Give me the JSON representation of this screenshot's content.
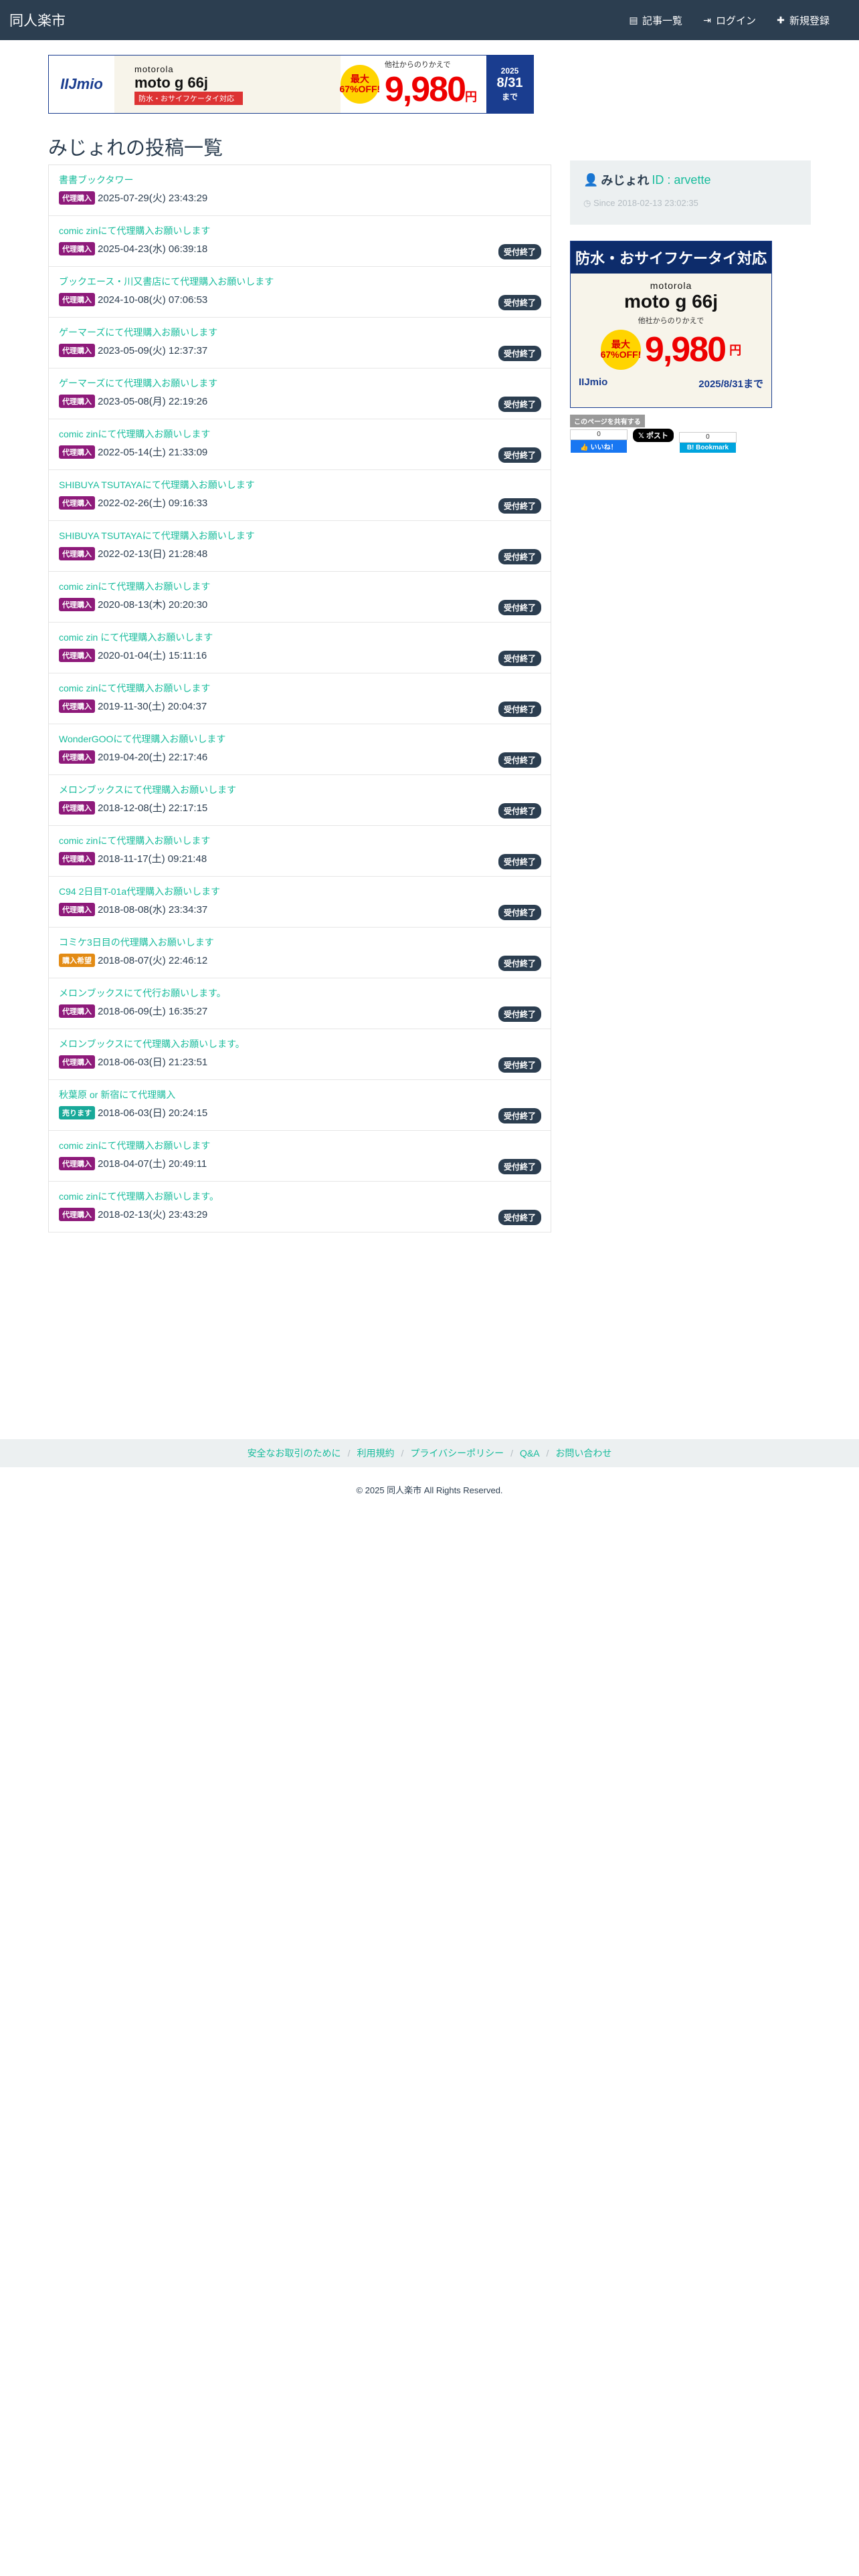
{
  "nav": {
    "brand": "同人楽市",
    "links": [
      {
        "icon": "list-icon",
        "label": "記事一覧"
      },
      {
        "icon": "login-icon",
        "label": "ログイン"
      },
      {
        "icon": "plus-icon",
        "label": "新規登録"
      }
    ]
  },
  "ad_top": {
    "logo": "IIJmio",
    "brand": "motorola",
    "phone": "moto g 66j",
    "tagline": "防水・おサイフケータイ対応",
    "note": "他社からのりかえで",
    "discount": "最大67%OFF!",
    "price": "9,980",
    "yen": "円",
    "year": "2025",
    "until": "8/31",
    "made": "まで"
  },
  "page": {
    "title": "みじょれの投稿一覧"
  },
  "colors": {
    "accent": "#18bc9c",
    "navbar": "#2c3e50",
    "purchase_label": "#8e1a7a",
    "wanted_label": "#e38b14",
    "sell_label": "#18a999"
  },
  "posts": [
    {
      "title": "書書ブックタワー",
      "label": "代理購入",
      "label_color": "#8e1a7a",
      "date": "2025-07-29(火) 23:43:29",
      "status": ""
    },
    {
      "title": "comic zinにて代理購入お願いします",
      "label": "代理購入",
      "label_color": "#8e1a7a",
      "date": "2025-04-23(水) 06:39:18",
      "status": "受付終了"
    },
    {
      "title": "ブックエース・川又書店にて代理購入お願いします",
      "label": "代理購入",
      "label_color": "#8e1a7a",
      "date": "2024-10-08(火) 07:06:53",
      "status": "受付終了"
    },
    {
      "title": "ゲーマーズにて代理購入お願いします",
      "label": "代理購入",
      "label_color": "#8e1a7a",
      "date": "2023-05-09(火) 12:37:37",
      "status": "受付終了"
    },
    {
      "title": "ゲーマーズにて代理購入お願いします",
      "label": "代理購入",
      "label_color": "#8e1a7a",
      "date": "2023-05-08(月) 22:19:26",
      "status": "受付終了"
    },
    {
      "title": "comic zinにて代理購入お願いします",
      "label": "代理購入",
      "label_color": "#8e1a7a",
      "date": "2022-05-14(土) 21:33:09",
      "status": "受付終了"
    },
    {
      "title": "SHIBUYA TSUTAYAにて代理購入お願いします",
      "label": "代理購入",
      "label_color": "#8e1a7a",
      "date": "2022-02-26(土) 09:16:33",
      "status": "受付終了"
    },
    {
      "title": "SHIBUYA TSUTAYAにて代理購入お願いします",
      "label": "代理購入",
      "label_color": "#8e1a7a",
      "date": "2022-02-13(日) 21:28:48",
      "status": "受付終了"
    },
    {
      "title": "comic zinにて代理購入お願いします",
      "label": "代理購入",
      "label_color": "#8e1a7a",
      "date": "2020-08-13(木) 20:20:30",
      "status": "受付終了"
    },
    {
      "title": "comic zin にて代理購入お願いします",
      "label": "代理購入",
      "label_color": "#8e1a7a",
      "date": "2020-01-04(土) 15:11:16",
      "status": "受付終了"
    },
    {
      "title": "comic zinにて代理購入お願いします",
      "label": "代理購入",
      "label_color": "#8e1a7a",
      "date": "2019-11-30(土) 20:04:37",
      "status": "受付終了"
    },
    {
      "title": "WonderGOOにて代理購入お願いします",
      "label": "代理購入",
      "label_color": "#8e1a7a",
      "date": "2019-04-20(土) 22:17:46",
      "status": "受付終了"
    },
    {
      "title": "メロンブックスにて代理購入お願いします",
      "label": "代理購入",
      "label_color": "#8e1a7a",
      "date": "2018-12-08(土) 22:17:15",
      "status": "受付終了"
    },
    {
      "title": "comic zinにて代理購入お願いします",
      "label": "代理購入",
      "label_color": "#8e1a7a",
      "date": "2018-11-17(土) 09:21:48",
      "status": "受付終了"
    },
    {
      "title": "C94 2日目T-01a代理購入お願いします",
      "label": "代理購入",
      "label_color": "#8e1a7a",
      "date": "2018-08-08(水) 23:34:37",
      "status": "受付終了"
    },
    {
      "title": "コミケ3日目の代理購入お願いします",
      "label": "購入希望",
      "label_color": "#e38b14",
      "date": "2018-08-07(火) 22:46:12",
      "status": "受付終了"
    },
    {
      "title": "メロンブックスにて代行お願いします。",
      "label": "代理購入",
      "label_color": "#8e1a7a",
      "date": "2018-06-09(土) 16:35:27",
      "status": "受付終了"
    },
    {
      "title": "メロンブックスにて代理購入お願いします。",
      "label": "代理購入",
      "label_color": "#8e1a7a",
      "date": "2018-06-03(日) 21:23:51",
      "status": "受付終了"
    },
    {
      "title": "秋葉原 or 新宿にて代理購入",
      "label": "売ります",
      "label_color": "#18a999",
      "date": "2018-06-03(日) 20:24:15",
      "status": "受付終了"
    },
    {
      "title": "comic zinにて代理購入お願いします",
      "label": "代理購入",
      "label_color": "#8e1a7a",
      "date": "2018-04-07(土) 20:49:11",
      "status": "受付終了"
    },
    {
      "title": "comic zinにて代理購入お願いします。",
      "label": "代理購入",
      "label_color": "#8e1a7a",
      "date": "2018-02-13(火) 23:43:29",
      "status": "受付終了"
    }
  ],
  "profile": {
    "name": "みじょれ",
    "id_label": "ID : arvette",
    "since": "Since 2018-02-13 23:02:35"
  },
  "ad_side": {
    "headline": "防水・おサイフケータイ対応",
    "brand": "motorola",
    "phone": "moto g 66j",
    "note": "他社からのりかえで",
    "discount": "最大67%OFF!",
    "price": "9,980",
    "yen": "円",
    "logo": "IIJmio",
    "until": "2025/8/31まで"
  },
  "share": {
    "label": "このページを共有する",
    "fb_count": "0",
    "fb_label": "いいね！",
    "x_label": "ポスト",
    "hb_count": "0",
    "hb_label": "Bookmark"
  },
  "footer": {
    "links": [
      "安全なお取引のために",
      "利用規約",
      "プライバシーポリシー",
      "Q&A",
      "お問い合わせ"
    ],
    "copyright": "© 2025 同人楽市 All Rights Reserved."
  }
}
